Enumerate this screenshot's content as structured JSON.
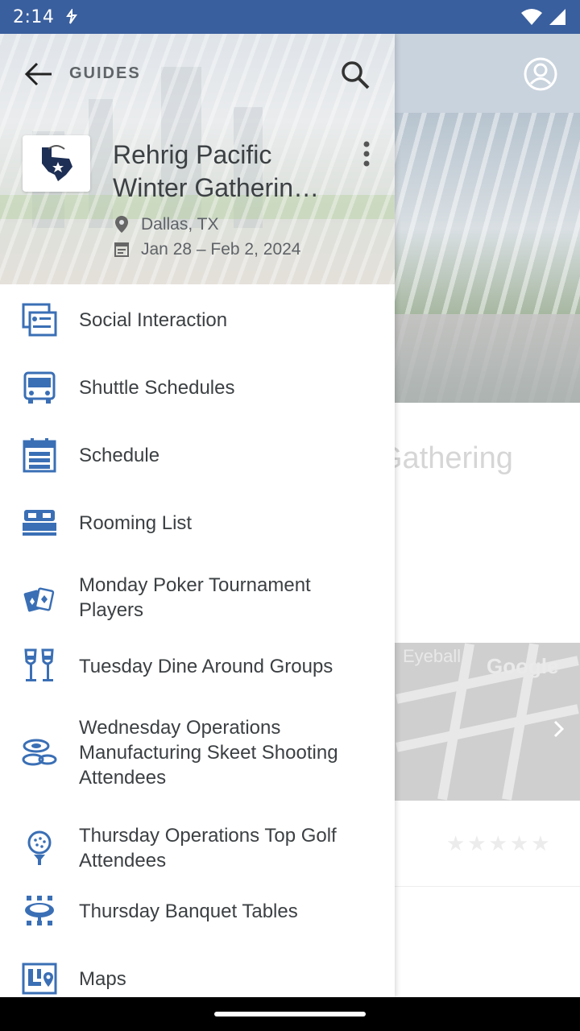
{
  "status_bar": {
    "time": "2:14"
  },
  "background": {
    "title_fragment": "Gathering",
    "map_label": "Eyeball",
    "map_logo": "Google",
    "rating": "★★★★★"
  },
  "drawer": {
    "header": {
      "section_label": "GUIDES",
      "event_title_line1": "Rehrig Pacific",
      "event_title_line2": "Winter Gatherin…",
      "location": "Dallas, TX",
      "dates": "Jan 28 – Feb 2, 2024"
    },
    "items": [
      {
        "label": "Social Interaction",
        "icon": "social-interaction-icon"
      },
      {
        "label": "Shuttle Schedules",
        "icon": "bus-icon"
      },
      {
        "label": "Schedule",
        "icon": "schedule-list-icon"
      },
      {
        "label": "Rooming List",
        "icon": "bed-icon"
      },
      {
        "label": "Monday Poker Tournament Players",
        "icon": "playing-cards-icon"
      },
      {
        "label": "Tuesday Dine Around Groups",
        "icon": "wine-glasses-icon"
      },
      {
        "label": "Wednesday Operations Manufacturing Skeet Shooting Attendees",
        "icon": "clay-target-icon"
      },
      {
        "label": "Thursday Operations Top Golf Attendees",
        "icon": "golf-ball-tee-icon"
      },
      {
        "label": "Thursday Banquet Tables",
        "icon": "banquet-table-icon"
      },
      {
        "label": "Maps",
        "icon": "map-icon"
      }
    ]
  },
  "colors": {
    "accent": "#3a5f9e",
    "icon_blue": "#3a6fb5",
    "text": "#3c4043"
  }
}
